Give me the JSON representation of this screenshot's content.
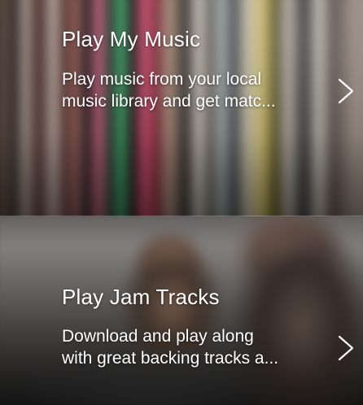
{
  "cards": [
    {
      "title": "Play My Music",
      "description_line1": "Play music from your local",
      "description_line2": "music library and get matc...",
      "background": "vinyl-records-image",
      "chevron_icon": "chevron-right-icon"
    },
    {
      "title": "Play Jam Tracks",
      "description_line1": "Download and play along",
      "description_line2": "with great backing tracks a...",
      "background": "band-jamming-image",
      "chevron_icon": "chevron-right-icon"
    }
  ],
  "colors": {
    "text": "#ffffff",
    "chevron": "#ffffff"
  }
}
